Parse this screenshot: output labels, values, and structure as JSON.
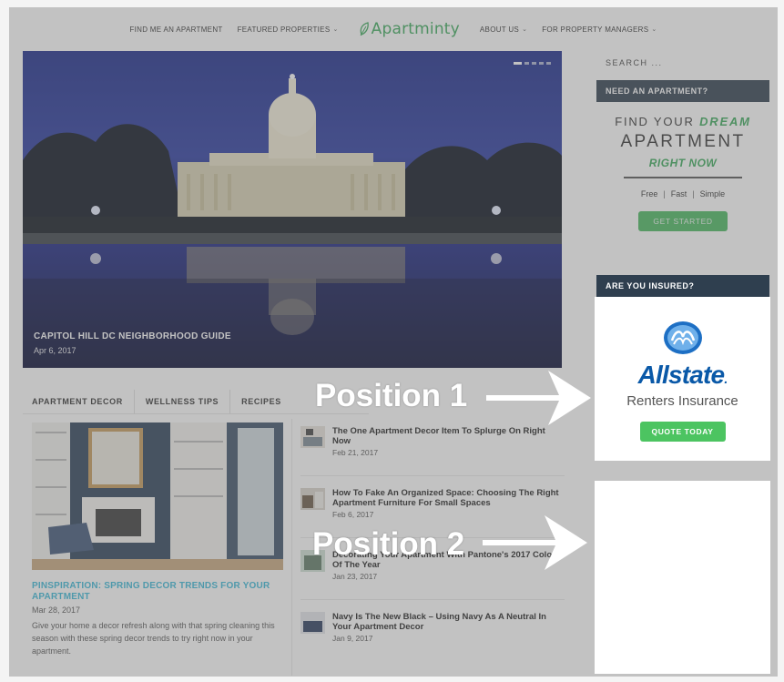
{
  "nav": {
    "items_left": [
      {
        "label": "FIND ME AN APARTMENT",
        "dropdown": false
      },
      {
        "label": "FEATURED PROPERTIES",
        "dropdown": true
      }
    ],
    "logo_text": "Apartminty",
    "items_right": [
      {
        "label": "ABOUT US",
        "dropdown": true
      },
      {
        "label": "FOR PROPERTY MANAGERS",
        "dropdown": true
      }
    ]
  },
  "hero": {
    "title": "CAPITOL HILL DC NEIGHBORHOOD GUIDE",
    "date": "Apr 6, 2017",
    "slider_dots": 5,
    "active_dot": 0
  },
  "tabs": [
    "APARTMENT DECOR",
    "WELLNESS TIPS",
    "RECIPES"
  ],
  "featured_post": {
    "title": "PINSPIRATION: SPRING DECOR TRENDS FOR YOUR APARTMENT",
    "date": "Mar 28, 2017",
    "excerpt": "Give your home a decor refresh along with that spring cleaning this season with these spring decor trends to try right now in your apartment."
  },
  "posts": [
    {
      "title": "The One Apartment Decor Item To Splurge On Right Now",
      "date": "Feb 21, 2017"
    },
    {
      "title": "How To Fake An Organized Space: Choosing The Right Apartment Furniture For Small Spaces",
      "date": "Feb 6, 2017"
    },
    {
      "title": "Decorating Your Apartment With Pantone's 2017 Color Of The Year",
      "date": "Jan 23, 2017"
    },
    {
      "title": "Navy Is The New Black – Using Navy As A Neutral In Your Apartment Decor",
      "date": "Jan 9, 2017"
    }
  ],
  "sidebar": {
    "search_placeholder": "SEARCH ...",
    "need_header": "NEED AN APARTMENT?",
    "dream_line1_a": "FIND YOUR",
    "dream_line1_b": "DREAM",
    "dream_line2": "APARTMENT",
    "dream_line3": "RIGHT NOW",
    "features": [
      "Free",
      "Fast",
      "Simple"
    ],
    "get_started": "GET STARTED",
    "insured_header": "ARE YOU INSURED?",
    "allstate_word": "Allstate",
    "allstate_sub": "Renters Insurance",
    "quote_button": "QUOTE TODAY"
  },
  "annotations": {
    "position1": "Position 1",
    "position2": "Position 2"
  },
  "colors": {
    "brand_green": "#3aaa5a",
    "link_blue": "#3ab8d8",
    "sidebar_header": "#2f3f4f",
    "allstate_blue": "#0a59a8"
  }
}
